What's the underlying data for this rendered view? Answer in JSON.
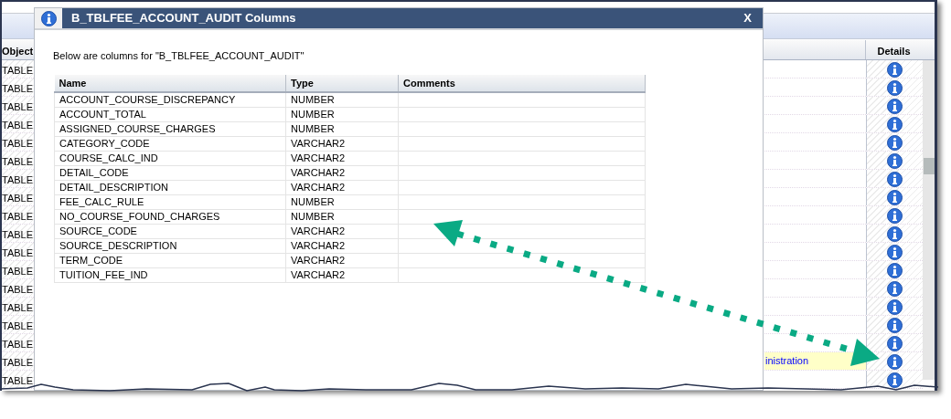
{
  "background_grid": {
    "columns": [
      {
        "label": "Object"
      },
      {
        "label": "Details"
      }
    ],
    "rows": [
      {
        "object": "TABLE",
        "highlighted": false
      },
      {
        "object": "TABLE",
        "highlighted": false
      },
      {
        "object": "TABLE",
        "highlighted": false
      },
      {
        "object": "TABLE",
        "highlighted": false
      },
      {
        "object": "TABLE",
        "highlighted": false
      },
      {
        "object": "TABLE",
        "highlighted": false
      },
      {
        "object": "TABLE",
        "highlighted": false
      },
      {
        "object": "TABLE",
        "highlighted": false
      },
      {
        "object": "TABLE",
        "highlighted": false
      },
      {
        "object": "TABLE",
        "highlighted": false
      },
      {
        "object": "TABLE",
        "highlighted": false
      },
      {
        "object": "TABLE",
        "highlighted": false
      },
      {
        "object": "TABLE",
        "highlighted": false
      },
      {
        "object": "TABLE",
        "highlighted": false
      },
      {
        "object": "TABLE",
        "highlighted": false
      },
      {
        "object": "TABLE",
        "highlighted": false
      },
      {
        "object": "TABLE",
        "highlighted": true,
        "link_text": "inistration"
      },
      {
        "object": "TABLE",
        "highlighted": false
      }
    ]
  },
  "dialog": {
    "title": "B_TBLFEE_ACCOUNT_AUDIT Columns",
    "close": "X",
    "message": "Below are columns for \"B_TBLFEE_ACCOUNT_AUDIT\"",
    "columns": [
      "Name",
      "Type",
      "Comments"
    ],
    "rows": [
      {
        "name": "ACCOUNT_COURSE_DISCREPANCY",
        "type": "NUMBER"
      },
      {
        "name": "ACCOUNT_TOTAL",
        "type": "NUMBER"
      },
      {
        "name": "ASSIGNED_COURSE_CHARGES",
        "type": "NUMBER"
      },
      {
        "name": "CATEGORY_CODE",
        "type": "VARCHAR2"
      },
      {
        "name": "COURSE_CALC_IND",
        "type": "VARCHAR2"
      },
      {
        "name": "DETAIL_CODE",
        "type": "VARCHAR2"
      },
      {
        "name": "DETAIL_DESCRIPTION",
        "type": "VARCHAR2"
      },
      {
        "name": "FEE_CALC_RULE",
        "type": "NUMBER"
      },
      {
        "name": "NO_COURSE_FOUND_CHARGES",
        "type": "NUMBER"
      },
      {
        "name": "SOURCE_CODE",
        "type": "VARCHAR2"
      },
      {
        "name": "SOURCE_DESCRIPTION",
        "type": "VARCHAR2"
      },
      {
        "name": "TERM_CODE",
        "type": "VARCHAR2"
      },
      {
        "name": "TUITION_FEE_IND",
        "type": "VARCHAR2"
      }
    ]
  }
}
